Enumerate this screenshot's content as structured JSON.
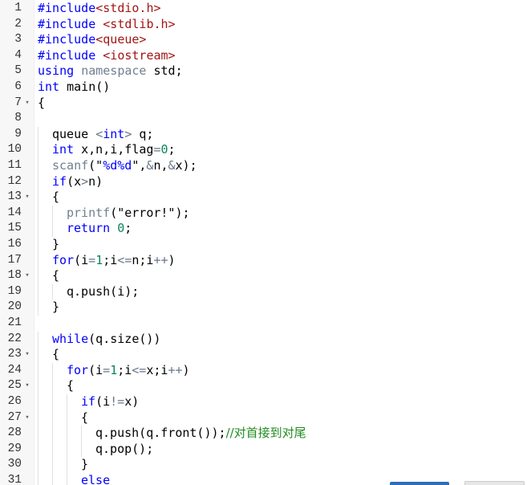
{
  "editor": {
    "lines": [
      {
        "n": "1",
        "fold": "",
        "indent": 0,
        "tokens": [
          {
            "t": "#include",
            "c": "kw"
          },
          {
            "t": "<stdio.h>",
            "c": "str"
          }
        ]
      },
      {
        "n": "2",
        "fold": "",
        "indent": 0,
        "tokens": [
          {
            "t": "#include ",
            "c": "kw"
          },
          {
            "t": "<stdlib.h>",
            "c": "str"
          }
        ]
      },
      {
        "n": "3",
        "fold": "",
        "indent": 0,
        "tokens": [
          {
            "t": "#include",
            "c": "kw"
          },
          {
            "t": "<queue>",
            "c": "str"
          }
        ]
      },
      {
        "n": "4",
        "fold": "",
        "indent": 0,
        "tokens": [
          {
            "t": "#include ",
            "c": "kw"
          },
          {
            "t": "<iostream>",
            "c": "str"
          }
        ]
      },
      {
        "n": "5",
        "fold": "",
        "indent": 0,
        "tokens": [
          {
            "t": "using",
            "c": "kw"
          },
          {
            "t": " ",
            "c": ""
          },
          {
            "t": "namespace",
            "c": "ns"
          },
          {
            "t": " std;",
            "c": ""
          }
        ]
      },
      {
        "n": "6",
        "fold": "",
        "indent": 0,
        "tokens": [
          {
            "t": "int",
            "c": "kw"
          },
          {
            "t": " main()",
            "c": ""
          }
        ]
      },
      {
        "n": "7",
        "fold": "▾",
        "indent": 0,
        "tokens": [
          {
            "t": "{",
            "c": ""
          }
        ]
      },
      {
        "n": "8",
        "fold": "",
        "indent": 0,
        "tokens": []
      },
      {
        "n": "9",
        "fold": "",
        "indent": 1,
        "tokens": [
          {
            "t": "queue ",
            "c": ""
          },
          {
            "t": "<",
            "c": "op"
          },
          {
            "t": "int",
            "c": "kw"
          },
          {
            "t": ">",
            "c": "op"
          },
          {
            "t": " q;",
            "c": ""
          }
        ]
      },
      {
        "n": "10",
        "fold": "",
        "indent": 1,
        "tokens": [
          {
            "t": "int",
            "c": "kw"
          },
          {
            "t": " x,n,i,flag",
            "c": ""
          },
          {
            "t": "=",
            "c": "op"
          },
          {
            "t": "0",
            "c": "num"
          },
          {
            "t": ";",
            "c": ""
          }
        ]
      },
      {
        "n": "11",
        "fold": "",
        "indent": 1,
        "tokens": [
          {
            "t": "scanf",
            "c": "ns"
          },
          {
            "t": "(\"",
            "c": ""
          },
          {
            "t": "%d%d",
            "c": "str2"
          },
          {
            "t": "\",",
            "c": ""
          },
          {
            "t": "&",
            "c": "op"
          },
          {
            "t": "n,",
            "c": ""
          },
          {
            "t": "&",
            "c": "op"
          },
          {
            "t": "x);",
            "c": ""
          }
        ]
      },
      {
        "n": "12",
        "fold": "",
        "indent": 1,
        "tokens": [
          {
            "t": "if",
            "c": "kw"
          },
          {
            "t": "(x",
            "c": ""
          },
          {
            "t": ">",
            "c": "op"
          },
          {
            "t": "n)",
            "c": ""
          }
        ]
      },
      {
        "n": "13",
        "fold": "▾",
        "indent": 1,
        "tokens": [
          {
            "t": "{",
            "c": ""
          }
        ]
      },
      {
        "n": "14",
        "fold": "",
        "indent": 2,
        "tokens": [
          {
            "t": "printf",
            "c": "ns"
          },
          {
            "t": "(\"error!\");",
            "c": ""
          }
        ]
      },
      {
        "n": "15",
        "fold": "",
        "indent": 2,
        "tokens": [
          {
            "t": "return",
            "c": "kw"
          },
          {
            "t": " ",
            "c": ""
          },
          {
            "t": "0",
            "c": "num"
          },
          {
            "t": ";",
            "c": ""
          }
        ]
      },
      {
        "n": "16",
        "fold": "",
        "indent": 1,
        "tokens": [
          {
            "t": "}",
            "c": ""
          }
        ]
      },
      {
        "n": "17",
        "fold": "",
        "indent": 1,
        "tokens": [
          {
            "t": "for",
            "c": "kw"
          },
          {
            "t": "(i",
            "c": ""
          },
          {
            "t": "=",
            "c": "op"
          },
          {
            "t": "1",
            "c": "num"
          },
          {
            "t": ";i",
            "c": ""
          },
          {
            "t": "<=",
            "c": "op"
          },
          {
            "t": "n;i",
            "c": ""
          },
          {
            "t": "++",
            "c": "op"
          },
          {
            "t": ")",
            "c": ""
          }
        ]
      },
      {
        "n": "18",
        "fold": "▾",
        "indent": 1,
        "tokens": [
          {
            "t": "{",
            "c": ""
          }
        ]
      },
      {
        "n": "19",
        "fold": "",
        "indent": 2,
        "tokens": [
          {
            "t": "q.push(i);",
            "c": ""
          }
        ]
      },
      {
        "n": "20",
        "fold": "",
        "indent": 1,
        "tokens": [
          {
            "t": "}",
            "c": ""
          }
        ]
      },
      {
        "n": "21",
        "fold": "",
        "indent": 0,
        "tokens": []
      },
      {
        "n": "22",
        "fold": "",
        "indent": 1,
        "tokens": [
          {
            "t": "while",
            "c": "kw"
          },
          {
            "t": "(q.size())",
            "c": ""
          }
        ]
      },
      {
        "n": "23",
        "fold": "▾",
        "indent": 1,
        "tokens": [
          {
            "t": "{",
            "c": ""
          }
        ]
      },
      {
        "n": "24",
        "fold": "",
        "indent": 2,
        "tokens": [
          {
            "t": "for",
            "c": "kw"
          },
          {
            "t": "(i",
            "c": ""
          },
          {
            "t": "=",
            "c": "op"
          },
          {
            "t": "1",
            "c": "num"
          },
          {
            "t": ";i",
            "c": ""
          },
          {
            "t": "<=",
            "c": "op"
          },
          {
            "t": "x;i",
            "c": ""
          },
          {
            "t": "++",
            "c": "op"
          },
          {
            "t": ")",
            "c": ""
          }
        ]
      },
      {
        "n": "25",
        "fold": "▾",
        "indent": 2,
        "tokens": [
          {
            "t": "{",
            "c": ""
          }
        ]
      },
      {
        "n": "26",
        "fold": "",
        "indent": 3,
        "tokens": [
          {
            "t": "if",
            "c": "kw"
          },
          {
            "t": "(i",
            "c": ""
          },
          {
            "t": "!=",
            "c": "op"
          },
          {
            "t": "x)",
            "c": ""
          }
        ]
      },
      {
        "n": "27",
        "fold": "▾",
        "indent": 3,
        "tokens": [
          {
            "t": "{",
            "c": ""
          }
        ]
      },
      {
        "n": "28",
        "fold": "",
        "indent": 4,
        "tokens": [
          {
            "t": "q.push(q.front());",
            "c": ""
          },
          {
            "t": "//对首接到对尾",
            "c": "com"
          }
        ]
      },
      {
        "n": "29",
        "fold": "",
        "indent": 4,
        "tokens": [
          {
            "t": "q.pop();",
            "c": ""
          }
        ]
      },
      {
        "n": "30",
        "fold": "",
        "indent": 3,
        "tokens": [
          {
            "t": "}",
            "c": ""
          }
        ]
      },
      {
        "n": "31",
        "fold": "",
        "indent": 3,
        "tokens": [
          {
            "t": "else",
            "c": "kw"
          }
        ]
      }
    ],
    "colors": {
      "keyword": "#0000ff",
      "string": "#a31515",
      "number": "#098658",
      "comment": "#228b22"
    }
  }
}
